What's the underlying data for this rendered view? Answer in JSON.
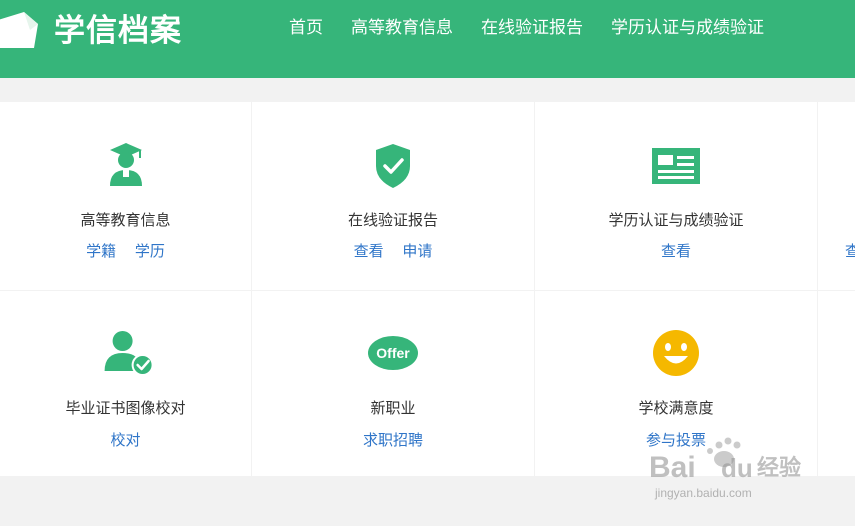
{
  "header": {
    "logo_text": "学信档案",
    "nav": [
      "首页",
      "高等教育信息",
      "在线验证报告",
      "学历认证与成绩验证"
    ]
  },
  "cards": [
    {
      "title": "高等教育信息",
      "links": [
        "学籍",
        "学历"
      ],
      "icon": "graduate-cap-icon"
    },
    {
      "title": "在线验证报告",
      "links": [
        "查看",
        "申请"
      ],
      "icon": "shield-check-icon"
    },
    {
      "title": "学历认证与成绩验证",
      "links": [
        "查看"
      ],
      "icon": "id-card-icon"
    },
    {
      "title": "毕业证书图像校对",
      "links": [
        "校对"
      ],
      "icon": "user-check-icon"
    },
    {
      "title": "新职业",
      "links": [
        "求职招聘"
      ],
      "icon": "offer-icon",
      "icon_text": "Offer"
    },
    {
      "title": "学校满意度",
      "links": [
        "参与投票"
      ],
      "icon": "smiley-icon"
    }
  ],
  "partial_column": {
    "link": "查"
  },
  "watermark": {
    "brand": "Bai",
    "brand2": "du",
    "cn": "经验",
    "url": "jingyan.baidu.com"
  },
  "colors": {
    "brand_green": "#36b57a",
    "link_blue": "#2f75c8",
    "smiley_yellow": "#f5b800"
  }
}
